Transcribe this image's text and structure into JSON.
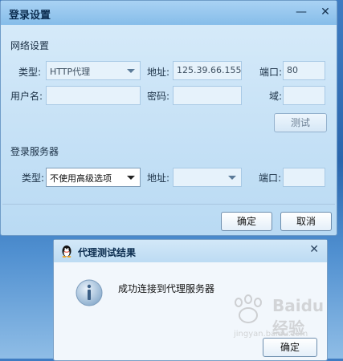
{
  "main_window": {
    "title": "登录设置",
    "minimize_glyph": "—",
    "close_glyph": "✕",
    "proxy_section": {
      "heading": "网络设置",
      "type_label": "类型:",
      "type_value": "HTTP代理",
      "address_label": "地址:",
      "address_value": "125.39.66.155",
      "port_label": "端口:",
      "port_value": "80",
      "username_label": "用户名:",
      "username_value": "",
      "password_label": "密码:",
      "password_value": "",
      "domain_label": "域:",
      "domain_value": "",
      "test_button": "测试"
    },
    "server_section": {
      "heading": "登录服务器",
      "type_label": "类型:",
      "type_value": "不使用高级选项",
      "address_label": "地址:",
      "address_value": "",
      "port_label": "端口:",
      "port_value": ""
    },
    "ok_button": "确定",
    "cancel_button": "取消"
  },
  "dialog": {
    "title": "代理测试结果",
    "close_glyph": "✕",
    "message": "成功连接到代理服务器",
    "ok_button": "确定",
    "icon": "info-icon"
  },
  "watermark": {
    "brand": "Baidu经验",
    "url": "jingyan.baidu.com"
  },
  "colors": {
    "window_bg": "#cbe4f7",
    "titlebar": "#86bde9",
    "desktop": "#2a66ad"
  }
}
